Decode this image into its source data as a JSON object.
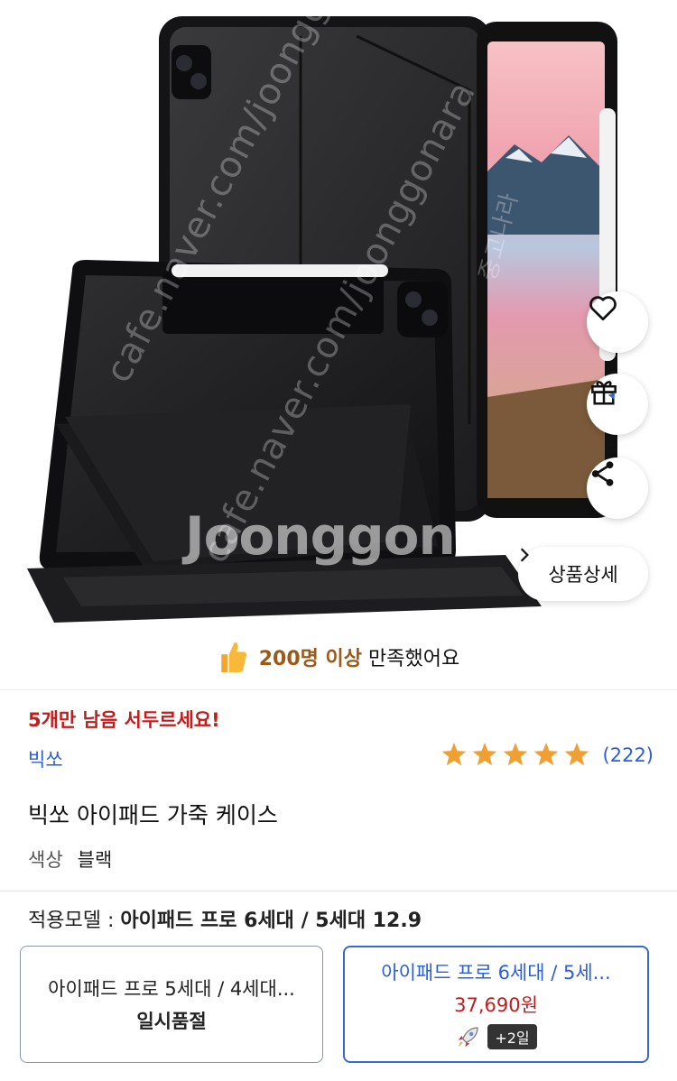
{
  "product_image": {
    "watermark_text": "cafe.naver.com/joonggonara",
    "watermark_logo": "Joonggonara",
    "watermark_kr": "중고나라"
  },
  "actions": {
    "like_icon": "heart-icon",
    "gift_icon": "gift-icon",
    "share_icon": "share-icon",
    "detail_label": "상품상세"
  },
  "satisfaction": {
    "icon": "thumbs-up-icon",
    "highlight": "200명 이상",
    "rest": "만족했어요"
  },
  "urgent_notice": "5개만 남음 서두르세요!",
  "brand": "빅쏘",
  "rating": {
    "stars": 5,
    "count": "(222)",
    "star_color": "#f0a032"
  },
  "title": "빅쏘 아이패드 가죽 케이스",
  "option": {
    "label": "색상",
    "value": "블랙"
  },
  "model_line": {
    "label": "적용모델 :",
    "value": "아이패드 프로 6세대 / 5세대 12.9"
  },
  "variants": [
    {
      "name": "아이패드 프로 5세대 / 4세대...",
      "status": "일시품절"
    },
    {
      "name": "아이패드 프로 6세대 / 5세...",
      "price": "37,690원",
      "shipping_badge": "+2일",
      "shipping_icon": "rocket-icon"
    }
  ],
  "colors": {
    "accent_blue": "#2b5fd9",
    "urgent_red": "#c01d1d",
    "satisfaction_brown": "#9b5a1a"
  }
}
